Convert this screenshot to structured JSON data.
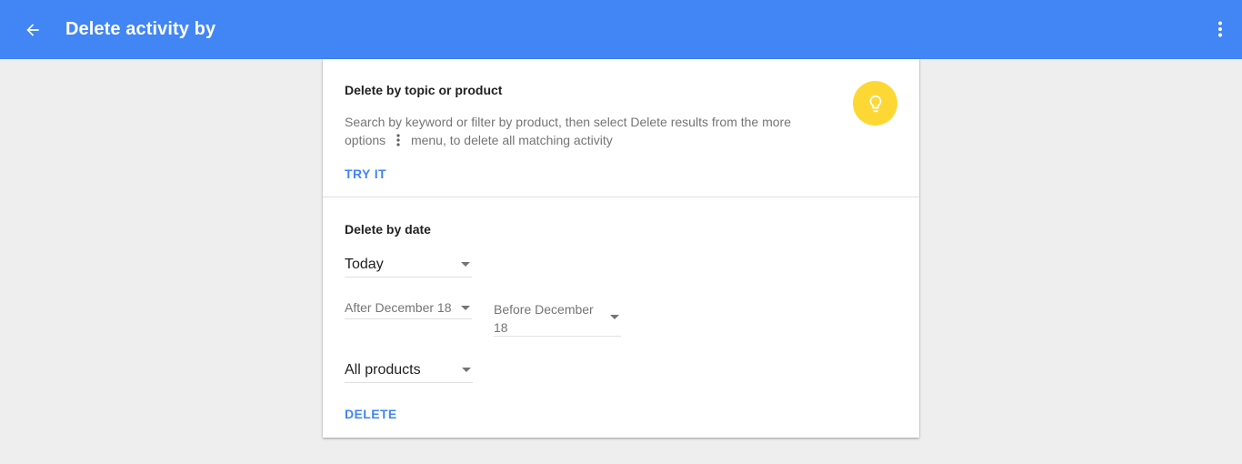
{
  "appbar": {
    "title": "Delete activity by",
    "back_icon": "arrow-back-icon",
    "more_icon": "more-vert-icon",
    "color": "#4285f4"
  },
  "topic_section": {
    "title": "Delete by topic or product",
    "description_before": "Search by keyword or filter by product, then select Delete results from the more options",
    "description_after": "menu, to delete all matching activity",
    "inline_icon": "more-vert-icon",
    "action_label": "TRY IT",
    "tip_icon": "lightbulb-icon",
    "tip_color": "#fdd835"
  },
  "date_section": {
    "title": "Delete by date",
    "range_select": {
      "value": "Today"
    },
    "after_select": {
      "value": "After December 18"
    },
    "before_select": {
      "value": "Before December 18"
    },
    "products_select": {
      "value": "All products"
    },
    "action_label": "DELETE"
  }
}
